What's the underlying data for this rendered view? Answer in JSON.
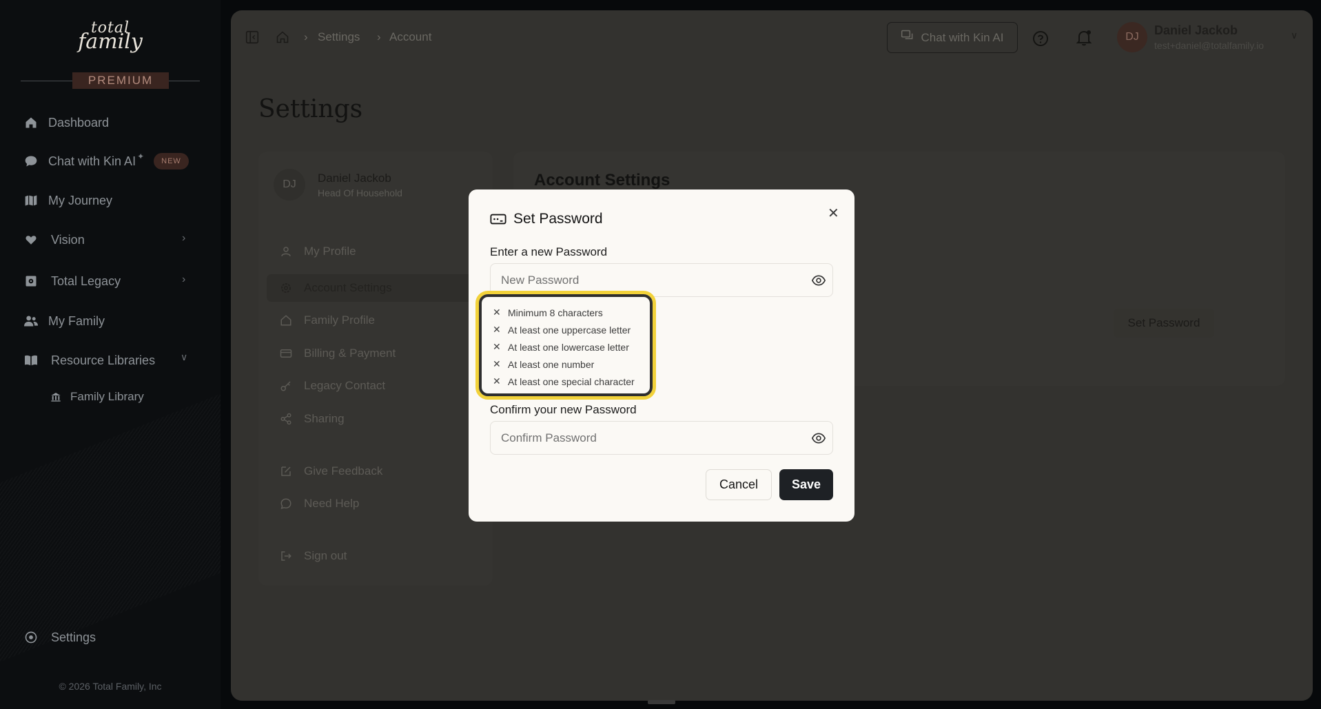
{
  "brand": {
    "logo_line1": "total",
    "logo_line2": "family",
    "tier": "PREMIUM"
  },
  "sidebar": {
    "items": [
      {
        "label": "Dashboard",
        "icon": "home-icon"
      },
      {
        "label": "Chat with Kin AI",
        "icon": "chat-bubble-icon",
        "badge": "NEW"
      },
      {
        "label": "My Journey",
        "icon": "map-icon"
      },
      {
        "label": "Vision",
        "icon": "heart-icon"
      },
      {
        "label": "Total Legacy",
        "icon": "safe-icon"
      },
      {
        "label": "My Family",
        "icon": "users-icon"
      },
      {
        "label": "Resource Libraries",
        "icon": "book-icon"
      },
      {
        "label": "Family Library",
        "icon": "library-icon"
      }
    ],
    "settings_label": "Settings",
    "copyright": "© 2026 Total Family, Inc"
  },
  "topbar": {
    "breadcrumb": [
      "Settings",
      "Account"
    ],
    "chat_button": "Chat with Kin AI",
    "user": {
      "initials": "DJ",
      "name": "Daniel Jackob",
      "email": "test+daniel@totalfamily.io"
    }
  },
  "page": {
    "title": "Settings",
    "profile": {
      "initials": "DJ",
      "name": "Daniel Jackob",
      "role": "Head Of Household"
    },
    "nav": [
      {
        "label": "My Profile",
        "icon": "user-icon"
      },
      {
        "label": "Account Settings",
        "icon": "gear-icon"
      },
      {
        "label": "Family Profile",
        "icon": "house-icon"
      },
      {
        "label": "Billing & Payment",
        "icon": "credit-card-icon"
      },
      {
        "label": "Legacy Contact",
        "icon": "key-icon"
      },
      {
        "label": "Sharing",
        "icon": "share-icon"
      },
      {
        "label": "Give Feedback",
        "icon": "edit-icon"
      },
      {
        "label": "Need Help",
        "icon": "message-circle-icon"
      },
      {
        "label": "Sign out",
        "icon": "logout-icon"
      }
    ],
    "account_settings_title": "Account Settings",
    "set_password_button": "Set Password"
  },
  "modal": {
    "title": "Set Password",
    "new_label": "Enter a new Password",
    "new_placeholder": "New Password",
    "rules": [
      "Minimum 8 characters",
      "At least one uppercase letter",
      "At least one lowercase letter",
      "At least one number",
      "At least one special character"
    ],
    "confirm_label": "Confirm your new Password",
    "confirm_placeholder": "Confirm Password",
    "cancel": "Cancel",
    "save": "Save"
  },
  "colors": {
    "highlight": "#f2d23a",
    "primary_button": "#1e2125",
    "premium_badge": "#3a2520"
  }
}
